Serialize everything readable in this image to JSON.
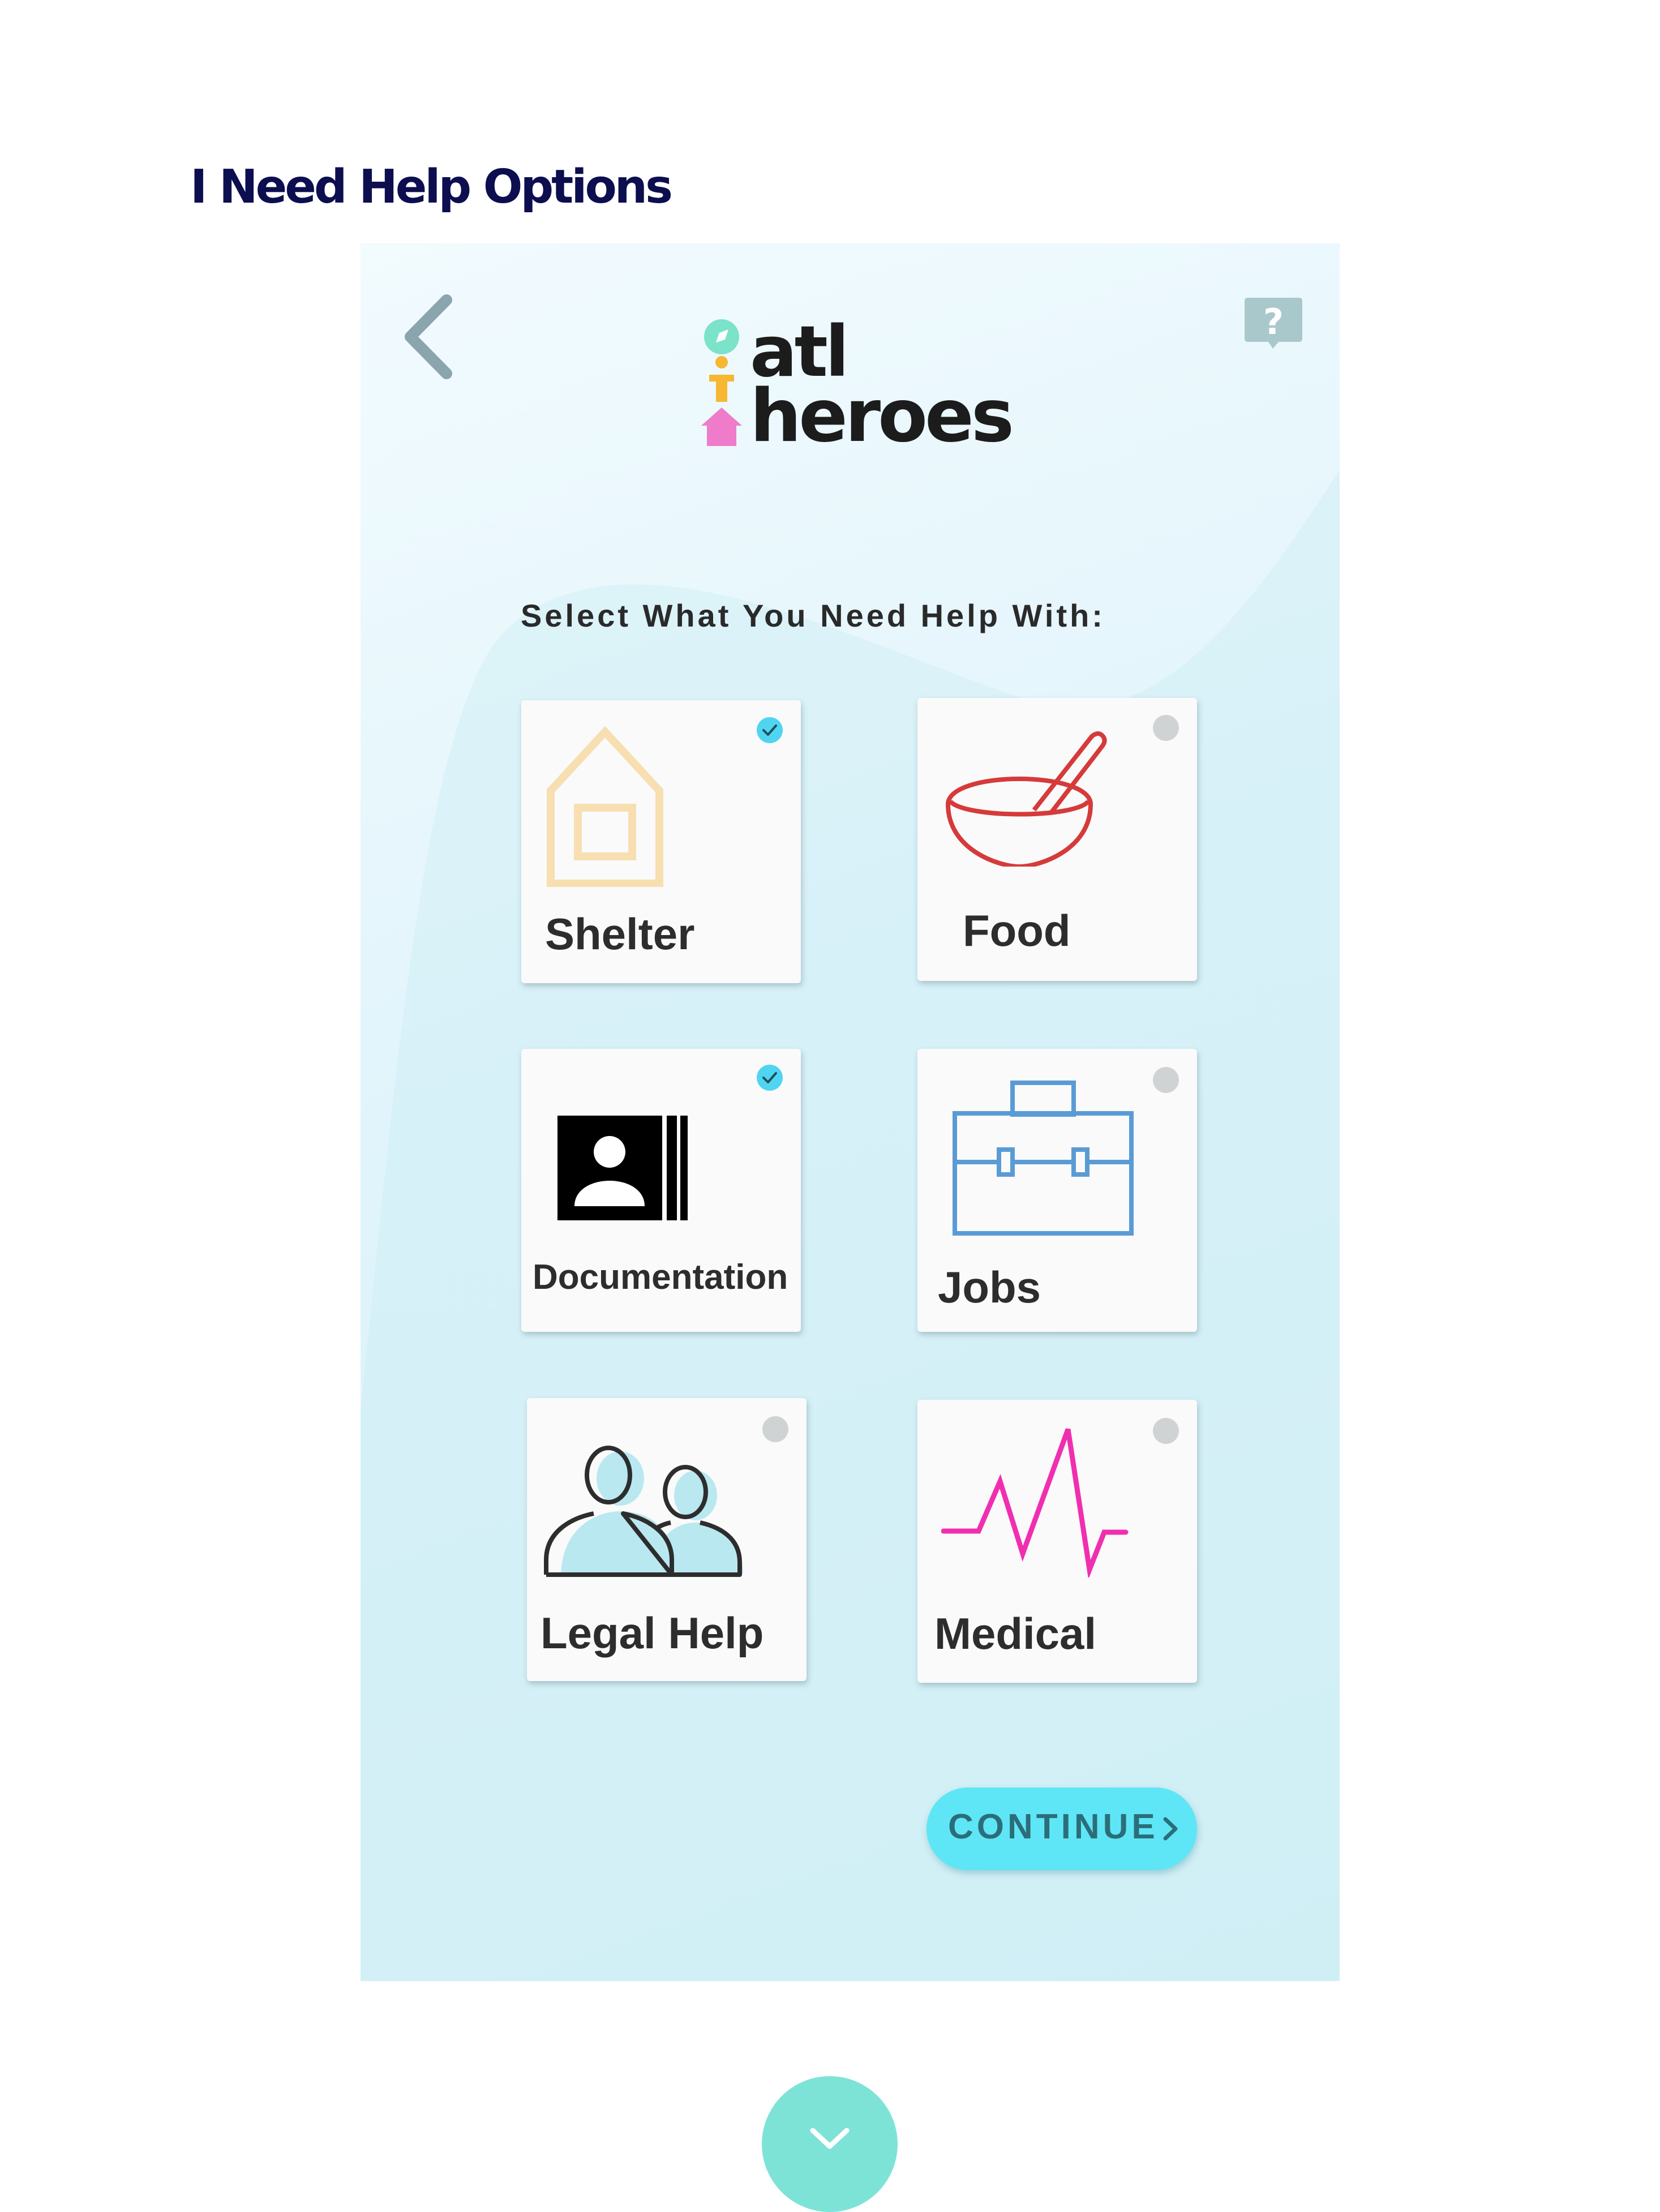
{
  "page": {
    "heading": "I Need Help Options"
  },
  "app": {
    "logo": {
      "line1": "atl",
      "line2": "heroes"
    },
    "prompt": "Select What You Need Help With:",
    "options": [
      {
        "label": "Shelter",
        "icon": "house-icon",
        "selected": true,
        "icon_color": "#f7dfb2"
      },
      {
        "label": "Food",
        "icon": "bowl-icon",
        "selected": false,
        "icon_color": "#d63a3a"
      },
      {
        "label": "Documentation",
        "icon": "id-card-icon",
        "selected": true,
        "icon_color": "#000000"
      },
      {
        "label": "Jobs",
        "icon": "briefcase-icon",
        "selected": false,
        "icon_color": "#5a9bd5"
      },
      {
        "label": "Legal Help",
        "icon": "people-icon",
        "selected": false,
        "icon_color": "#2d2d2d"
      },
      {
        "label": "Medical",
        "icon": "heartbeat-icon",
        "selected": false,
        "icon_color": "#f02fb0"
      }
    ],
    "continue_label": "CONTINUE"
  },
  "colors": {
    "heading": "#0d0e4f",
    "accent": "#5ee6f6",
    "selected_check": "#4fd4f2",
    "unselected_dot": "#cfd3d4",
    "scroll_button": "#7ee3d7"
  }
}
